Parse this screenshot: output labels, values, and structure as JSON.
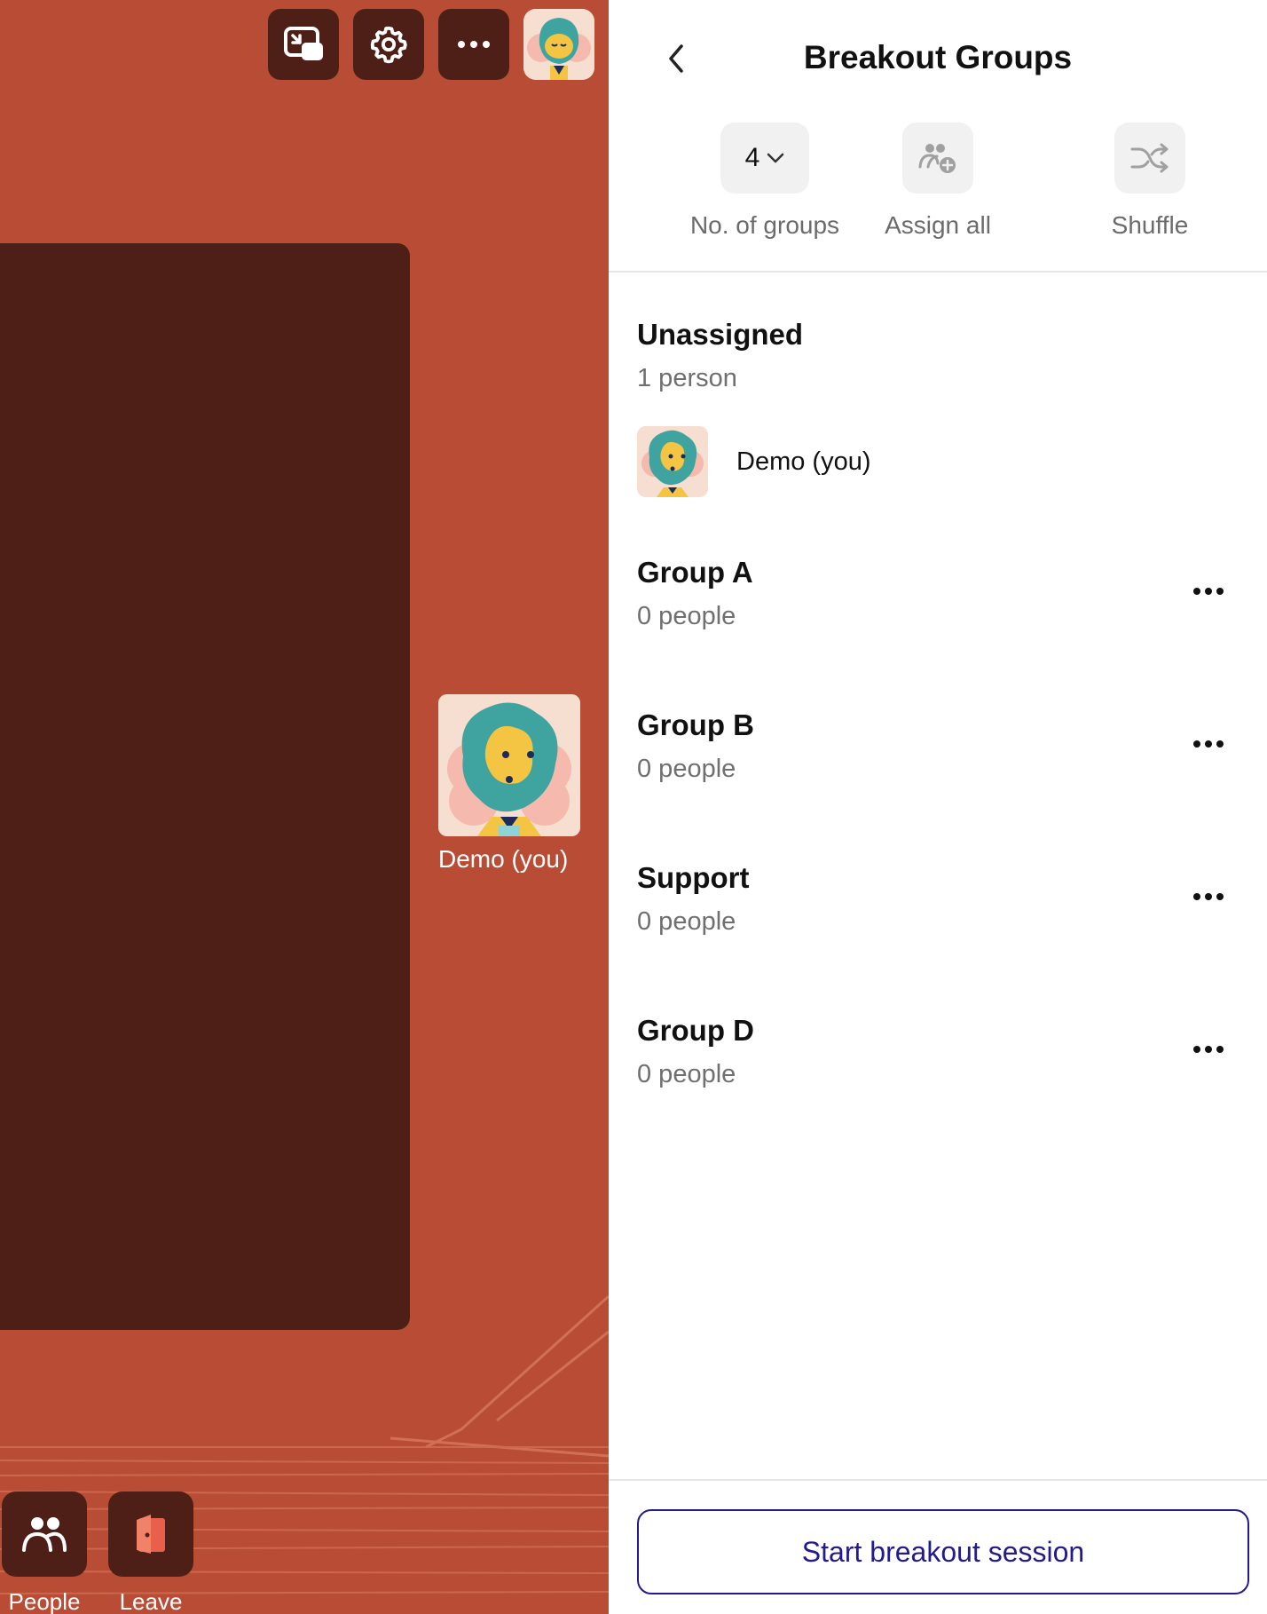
{
  "toolbar": {
    "icons": [
      "picture-in-picture-icon",
      "gear-icon",
      "more-horizontal-icon",
      "avatar"
    ]
  },
  "stage": {
    "self_name": "Demo (you)"
  },
  "dock": {
    "people_label": "People",
    "leave_label": "Leave"
  },
  "panel": {
    "title": "Breakout Groups",
    "controls": {
      "groups_count": "4",
      "groups_label": "No. of groups",
      "assign_label": "Assign all",
      "shuffle_label": "Shuffle"
    },
    "unassigned": {
      "title": "Unassigned",
      "count": "1 person",
      "members": [
        {
          "name": "Demo (you)"
        }
      ]
    },
    "groups": [
      {
        "name": "Group A",
        "count": "0 people"
      },
      {
        "name": "Group B",
        "count": "0 people"
      },
      {
        "name": "Support",
        "count": "0 people"
      },
      {
        "name": "Group D",
        "count": "0 people"
      }
    ],
    "start_label": "Start breakout session"
  },
  "colors": {
    "stage_bg": "#b84c35",
    "tile_dark": "#4e1f17",
    "accent": "#221b8a",
    "leave_icon": "#e8604a"
  }
}
